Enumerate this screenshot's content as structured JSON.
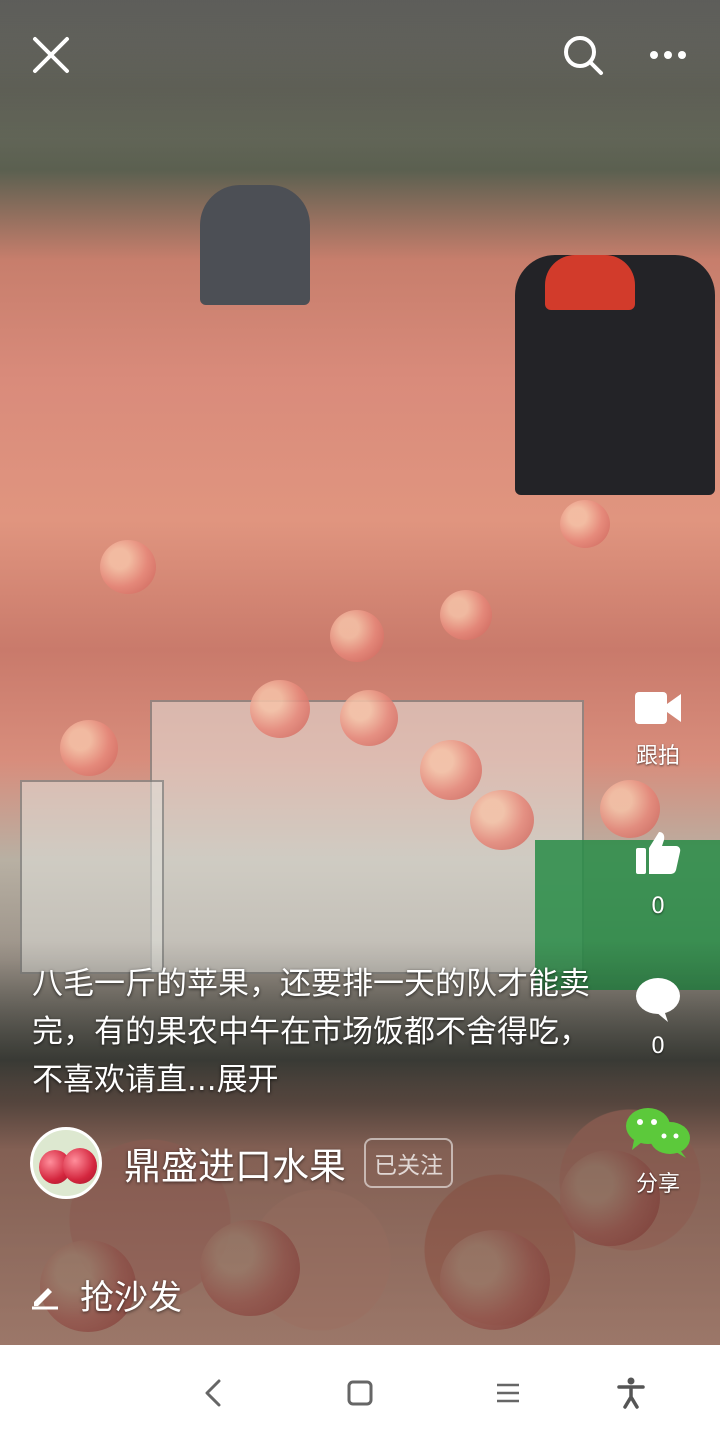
{
  "top_bar": {
    "close_icon": "close-icon",
    "search_icon": "search-icon",
    "more_icon": "more-dots-icon"
  },
  "side_actions": {
    "shoot": {
      "icon": "video-camera-icon",
      "label": "跟拍"
    },
    "like": {
      "icon": "thumbs-up-icon",
      "count": "0"
    },
    "comment": {
      "icon": "comment-bubble-icon",
      "count": "0"
    },
    "share": {
      "icon": "wechat-icon",
      "label": "分享",
      "color": "#5cc93b"
    }
  },
  "caption": {
    "text": "八毛一斤的苹果，还要排一天的队才能卖完，有的果农中午在市场饭都不舍得吃，不喜欢请直...",
    "expand_label": "展开"
  },
  "author": {
    "name": "鼎盛进口水果",
    "follow_label": "已关注"
  },
  "comment_input": {
    "icon": "pencil-icon",
    "placeholder": "抢沙发"
  },
  "system_nav": {
    "back": "back-icon",
    "home": "home-icon",
    "recents": "menu-icon",
    "accessibility": "accessibility-icon"
  }
}
